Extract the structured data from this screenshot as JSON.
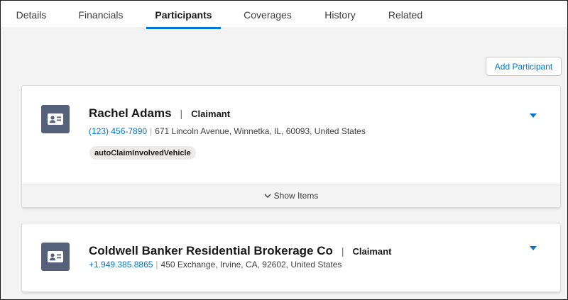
{
  "tabs": [
    {
      "label": "Details",
      "active": false
    },
    {
      "label": "Financials",
      "active": false
    },
    {
      "label": "Participants",
      "active": true
    },
    {
      "label": "Coverages",
      "active": false
    },
    {
      "label": "History",
      "active": false
    },
    {
      "label": "Related",
      "active": false
    }
  ],
  "toolbar": {
    "add_participant_label": "Add Participant"
  },
  "participants": [
    {
      "name": "Rachel Adams",
      "separator": "|",
      "role": "Claimant",
      "phone": "(123) 456-7890",
      "contact_separator": "|",
      "address": "671 Lincoln Avenue, Winnetka, IL, 60093, United States",
      "badge": "autoClaimInvolvedVehicle",
      "show_items_label": "Show Items",
      "icon": "contact-card-icon"
    },
    {
      "name": "Coldwell Banker Residential Brokerage Co",
      "separator": "|",
      "role": "Claimant",
      "phone": "+1.949.385.8865",
      "contact_separator": "|",
      "address": "450 Exchange, Irvine, CA, 92602, United States",
      "icon": "contact-card-icon"
    }
  ],
  "colors": {
    "accent": "#0176d3",
    "avatar_bg": "#546178",
    "background": "#f3f3f3"
  }
}
